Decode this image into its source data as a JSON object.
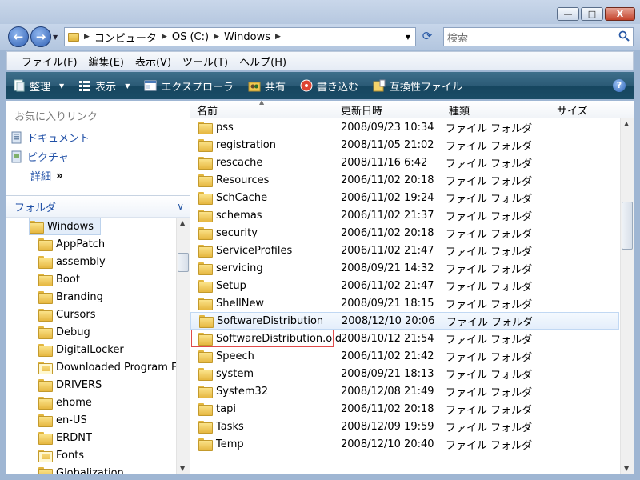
{
  "window": {
    "minimize": "—",
    "maximize": "□",
    "close": "X"
  },
  "address": {
    "segments": [
      "コンピュータ",
      "OS (C:)",
      "Windows"
    ],
    "search_placeholder": "検索"
  },
  "menu": [
    "ファイル(F)",
    "編集(E)",
    "表示(V)",
    "ツール(T)",
    "ヘルプ(H)"
  ],
  "toolbar": {
    "organize": "整理",
    "view": "表示",
    "explorer": "エクスプローラ",
    "share": "共有",
    "burn": "書き込む",
    "compat": "互換性ファイル",
    "help": "?"
  },
  "left": {
    "favorites_header": "お気に入りリンク",
    "favorites": [
      "ドキュメント",
      "ピクチャ"
    ],
    "details": "詳細",
    "folders_header": "フォルダ",
    "tree_root": "Windows",
    "tree_items": [
      {
        "label": "AppPatch",
        "special": false
      },
      {
        "label": "assembly",
        "special": false
      },
      {
        "label": "Boot",
        "special": false
      },
      {
        "label": "Branding",
        "special": false
      },
      {
        "label": "Cursors",
        "special": false
      },
      {
        "label": "Debug",
        "special": false
      },
      {
        "label": "DigitalLocker",
        "special": false
      },
      {
        "label": "Downloaded Program File",
        "special": true
      },
      {
        "label": "DRIVERS",
        "special": false
      },
      {
        "label": "ehome",
        "special": false
      },
      {
        "label": "en-US",
        "special": false
      },
      {
        "label": "ERDNT",
        "special": false
      },
      {
        "label": "Fonts",
        "special": true
      },
      {
        "label": "Globalization",
        "special": false
      }
    ]
  },
  "columns": {
    "name": "名前",
    "date": "更新日時",
    "type": "種類",
    "size": "サイズ"
  },
  "files": [
    {
      "name": "pss",
      "date": "2008/09/23 10:34",
      "type": "ファイル フォルダ"
    },
    {
      "name": "registration",
      "date": "2008/11/05 21:02",
      "type": "ファイル フォルダ"
    },
    {
      "name": "rescache",
      "date": "2008/11/16 6:42",
      "type": "ファイル フォルダ"
    },
    {
      "name": "Resources",
      "date": "2006/11/02 20:18",
      "type": "ファイル フォルダ"
    },
    {
      "name": "SchCache",
      "date": "2006/11/02 19:24",
      "type": "ファイル フォルダ"
    },
    {
      "name": "schemas",
      "date": "2006/11/02 21:37",
      "type": "ファイル フォルダ"
    },
    {
      "name": "security",
      "date": "2006/11/02 20:18",
      "type": "ファイル フォルダ"
    },
    {
      "name": "ServiceProfiles",
      "date": "2006/11/02 21:47",
      "type": "ファイル フォルダ"
    },
    {
      "name": "servicing",
      "date": "2008/09/21 14:32",
      "type": "ファイル フォルダ"
    },
    {
      "name": "Setup",
      "date": "2006/11/02 21:47",
      "type": "ファイル フォルダ"
    },
    {
      "name": "ShellNew",
      "date": "2008/09/21 18:15",
      "type": "ファイル フォルダ"
    },
    {
      "name": "SoftwareDistribution",
      "date": "2008/12/10 20:06",
      "type": "ファイル フォルダ"
    },
    {
      "name": "SoftwareDistribution.old",
      "date": "2008/10/12 21:54",
      "type": "ファイル フォルダ"
    },
    {
      "name": "Speech",
      "date": "2006/11/02 21:42",
      "type": "ファイル フォルダ"
    },
    {
      "name": "system",
      "date": "2008/09/21 18:13",
      "type": "ファイル フォルダ"
    },
    {
      "name": "System32",
      "date": "2008/12/08 21:49",
      "type": "ファイル フォルダ"
    },
    {
      "name": "tapi",
      "date": "2006/11/02 20:18",
      "type": "ファイル フォルダ"
    },
    {
      "name": "Tasks",
      "date": "2008/12/09 19:59",
      "type": "ファイル フォルダ"
    },
    {
      "name": "Temp",
      "date": "2008/12/10 20:40",
      "type": "ファイル フォルダ"
    }
  ],
  "hover_row": 11,
  "boxed_row": 12
}
